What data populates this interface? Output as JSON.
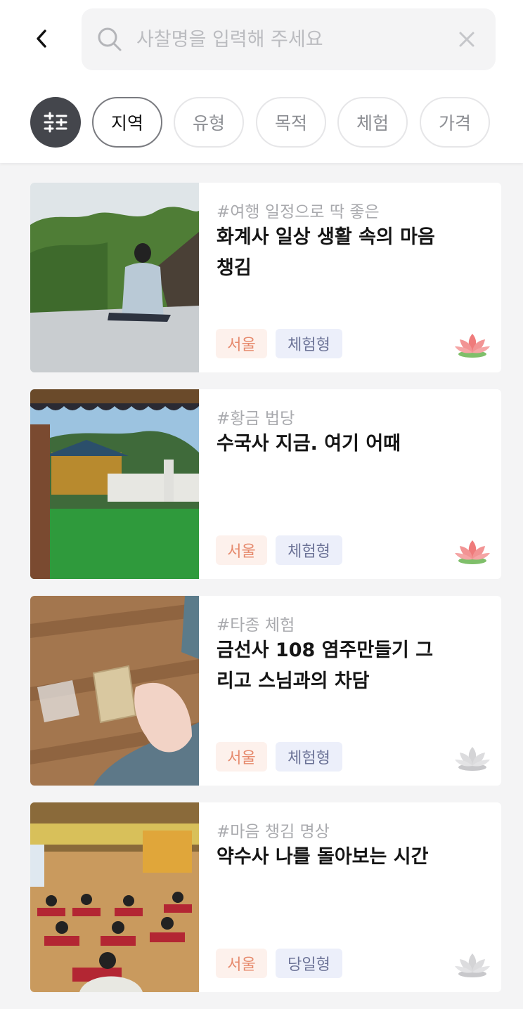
{
  "search": {
    "placeholder": "사찰명을 입력해 주세요",
    "value": ""
  },
  "filters": {
    "chips": [
      {
        "label": "지역",
        "active": true
      },
      {
        "label": "유형",
        "active": false
      },
      {
        "label": "목적",
        "active": false
      },
      {
        "label": "체험",
        "active": false
      },
      {
        "label": "가격",
        "active": false
      }
    ]
  },
  "icons": {
    "back": "chevron-left-icon",
    "search": "search-icon",
    "clear": "close-icon",
    "filter": "sliders-icon",
    "favorite": "lotus-icon"
  },
  "colors": {
    "lotus_active": "#ef7b7b",
    "lotus_inactive": "#d4d4d6",
    "tag_region_text": "#e68a6d",
    "tag_type_text": "#6c7397",
    "filter_button": "#44464c"
  },
  "programs": [
    {
      "hashtag": "#여행 일정으로 딱 좋은",
      "title": "화계사 일상 생활 속의 마음챙김",
      "region": "서울",
      "type": "체험형",
      "favorited": true
    },
    {
      "hashtag": "#황금 법당",
      "title": "수국사 지금. 여기 어때",
      "region": "서울",
      "type": "체험형",
      "favorited": true
    },
    {
      "hashtag": "#타종 체험",
      "title": "금선사 108 염주만들기 그리고 스님과의 차담",
      "region": "서울",
      "type": "체험형",
      "favorited": false
    },
    {
      "hashtag": "#마음 챙김 명상",
      "title": "약수사 나를 돌아보는 시간",
      "region": "서울",
      "type": "당일형",
      "favorited": false
    }
  ]
}
